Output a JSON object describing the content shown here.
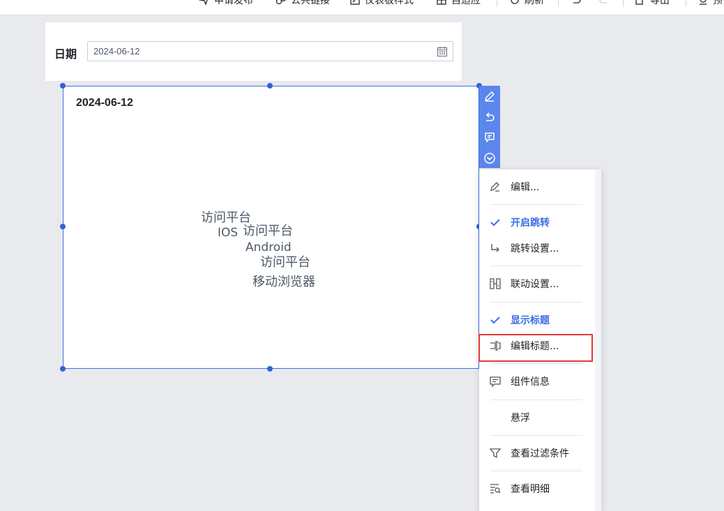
{
  "toolbar": {
    "items": [
      {
        "label": "申请发布",
        "icon": "send-icon"
      },
      {
        "label": "公共链接",
        "icon": "link-icon"
      },
      {
        "label": "仪表板样式",
        "icon": "style-icon"
      },
      {
        "label": "自适应",
        "icon": "fit-icon"
      },
      {
        "label": "刷新",
        "icon": "refresh-icon"
      },
      {
        "label": "导出",
        "icon": "export-icon"
      },
      {
        "label": "预",
        "icon": "preview-icon"
      }
    ]
  },
  "filter": {
    "label": "日期",
    "value": "2024-06-12",
    "icon": "calendar-icon"
  },
  "widget": {
    "title": "2024-06-12",
    "words": [
      "访问平台",
      "IOS",
      "访问平台",
      "Android",
      "访问平台",
      "移动浏览器"
    ]
  },
  "side_actions": [
    "edit-icon",
    "undo-icon",
    "comment-icon",
    "more-icon"
  ],
  "menu": {
    "items": [
      {
        "label": "编辑...",
        "icon": "edit-icon",
        "checked": false
      },
      {
        "label": "开启跳转",
        "icon": "check-icon",
        "checked": true
      },
      {
        "label": "跳转设置...",
        "icon": "jump-arrow-icon",
        "checked": false
      },
      {
        "label": "联动设置...",
        "icon": "linkage-icon",
        "checked": false
      },
      {
        "label": "显示标题",
        "icon": "check-icon",
        "checked": true
      },
      {
        "label": "编辑标题...",
        "icon": "edit-title-icon",
        "checked": false
      },
      {
        "label": "组件信息",
        "icon": "info-icon",
        "checked": false
      },
      {
        "label": "悬浮",
        "icon": "",
        "checked": false
      },
      {
        "label": "查看过滤条件",
        "icon": "filter-icon",
        "checked": false
      },
      {
        "label": "查看明细",
        "icon": "detail-icon",
        "checked": false
      }
    ]
  },
  "colors": {
    "accent": "#3a6ee6",
    "strip": "#5b86ec",
    "highlight": "#e53935",
    "canvas": "#e9eaee"
  }
}
